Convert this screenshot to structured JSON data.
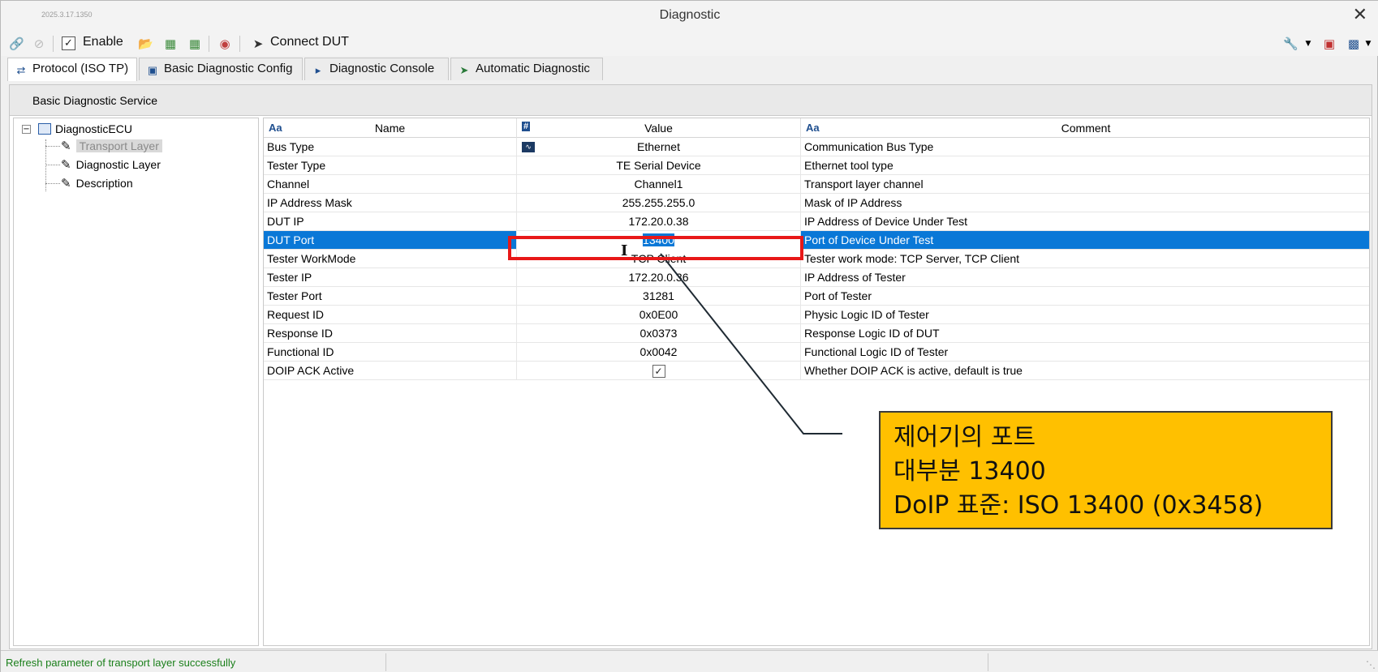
{
  "window": {
    "version": "2025.3.17.1350",
    "title": "Diagnostic",
    "close_glyph": "✕"
  },
  "toolbar": {
    "enable_label": "Enable",
    "enable_checked": true,
    "connect_label": "Connect DUT"
  },
  "tabs": [
    {
      "label": "Protocol (ISO TP)",
      "icon": "protocol-icon",
      "active": true
    },
    {
      "label": "Basic Diagnostic Config",
      "icon": "window-icon",
      "active": false
    },
    {
      "label": "Diagnostic Console",
      "icon": "console-icon",
      "active": false
    },
    {
      "label": "Automatic Diagnostic",
      "icon": "send-icon",
      "active": false
    }
  ],
  "section": {
    "title": "Basic Diagnostic Service"
  },
  "tree": {
    "root": "DiagnosticECU",
    "children": [
      "Transport Layer",
      "Diagnostic Layer",
      "Description"
    ],
    "selected": "Transport Layer"
  },
  "grid": {
    "headers": {
      "name": "Name",
      "value": "Value",
      "comment": "Comment",
      "text_type": "Aa",
      "num_type": "#"
    },
    "rows": [
      {
        "name": "Bus Type",
        "value": "Ethernet",
        "comment": "Communication Bus Type"
      },
      {
        "name": "Tester Type",
        "value": "TE Serial Device",
        "comment": "Ethernet tool type"
      },
      {
        "name": "Channel",
        "value": "Channel1",
        "comment": "Transport layer channel"
      },
      {
        "name": "IP Address Mask",
        "value": "255.255.255.0",
        "comment": "Mask of IP Address"
      },
      {
        "name": "DUT IP",
        "value": "172.20.0.38",
        "comment": "IP Address of Device Under Test"
      },
      {
        "name": "DUT Port",
        "value": "13400",
        "comment": "Port of Device Under Test"
      },
      {
        "name": "Tester WorkMode",
        "value": "TCP Client",
        "comment": "Tester work mode: TCP Server, TCP Client"
      },
      {
        "name": "Tester IP",
        "value": "172.20.0.36",
        "comment": "IP Address of Tester"
      },
      {
        "name": "Tester Port",
        "value": "31281",
        "comment": "Port of Tester"
      },
      {
        "name": "Request ID",
        "value": "0x0E00",
        "comment": "Physic Logic ID of Tester"
      },
      {
        "name": "Response ID",
        "value": "0x0373",
        "comment": "Response Logic ID of DUT"
      },
      {
        "name": "Functional ID",
        "value": "0x0042",
        "comment": "Functional Logic ID of Tester"
      },
      {
        "name": "DOIP ACK Active",
        "value": "",
        "comment": "Whether DOIP ACK is active, default is true",
        "checkbox": true,
        "checked": true
      }
    ]
  },
  "status": {
    "message": "Refresh parameter of transport layer successfully"
  },
  "annotation": {
    "lines": [
      "제어기의 포트",
      "대부분 13400",
      "DoIP 표준: ISO 13400  (0x3458)"
    ],
    "box_color": "#ffc000",
    "highlight_color": "#e81818"
  },
  "colors": {
    "selection": "#0a78d7",
    "status_ok": "#1a7f1a"
  }
}
